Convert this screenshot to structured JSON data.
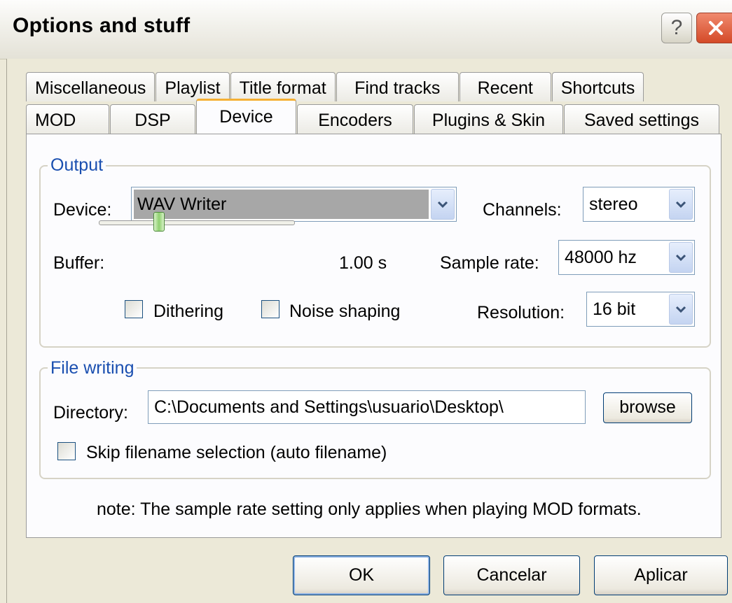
{
  "window": {
    "title": "Options and stuff",
    "help_label": "?",
    "close_label": "✕"
  },
  "tabs": {
    "row1": [
      "Miscellaneous",
      "Playlist",
      "Title format",
      "Find tracks",
      "Recent",
      "Shortcuts"
    ],
    "row2": [
      "MOD",
      "DSP",
      "Device",
      "Encoders",
      "Plugins & Skin",
      "Saved settings"
    ],
    "active": "Device"
  },
  "output": {
    "group_label": "Output",
    "device_label": "Device:",
    "device_value": "WAV Writer",
    "channels_label": "Channels:",
    "channels_value": "stereo",
    "buffer_label": "Buffer:",
    "buffer_value": "1.00 s",
    "sample_rate_label": "Sample rate:",
    "sample_rate_value": "48000 hz",
    "resolution_label": "Resolution:",
    "resolution_value": "16 bit",
    "dithering_label": "Dithering",
    "noise_shaping_label": "Noise shaping"
  },
  "file_writing": {
    "group_label": "File writing",
    "directory_label": "Directory:",
    "directory_value": "C:\\Documents and Settings\\usuario\\Desktop\\",
    "browse_label": "browse",
    "skip_label": "Skip filename selection (auto filename)"
  },
  "note": "note: The sample rate setting only applies when playing MOD formats.",
  "buttons": {
    "ok": "OK",
    "cancel": "Cancelar",
    "apply": "Aplicar"
  }
}
